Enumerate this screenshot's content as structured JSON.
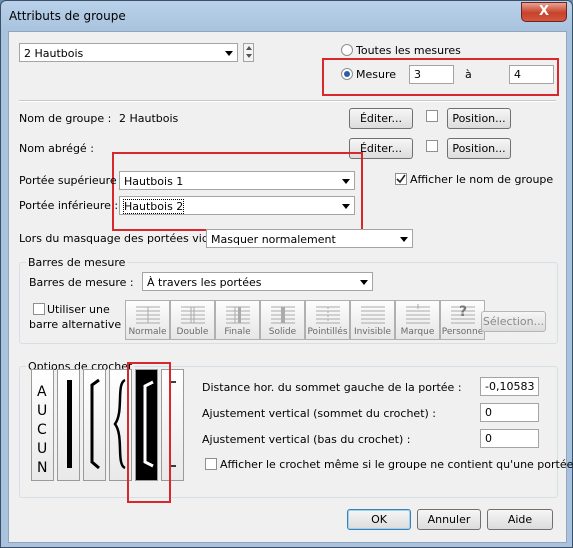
{
  "window": {
    "title": "Attributs de groupe",
    "close_glyph": "X"
  },
  "instrument_select": {
    "value": "2 Hautbois"
  },
  "range": {
    "all_label": "Toutes les mesures",
    "measure_label": "Mesure",
    "from": "3",
    "to_label": "à",
    "to": "4"
  },
  "group_name": {
    "label": "Nom de groupe :",
    "value": "2 Hautbois",
    "edit": "Éditer...",
    "position": "Position..."
  },
  "short_name": {
    "label": "Nom abrégé :",
    "edit": "Éditer...",
    "position": "Position..."
  },
  "staves": {
    "upper_label": "Portée supérieure",
    "upper_value": "Hautbois 1",
    "lower_label": "Portée inférieure :",
    "lower_value": "Hautbois 2",
    "show_name_label": "Afficher le nom de groupe"
  },
  "hide_empty": {
    "label": "Lors du masquage des portées vides :",
    "value": "Masquer normalement"
  },
  "barlines": {
    "group_title": "Barres de mesure",
    "label": "Barres de mesure :",
    "value": "À travers les portées",
    "alt_line1": "Utiliser une",
    "alt_line2": "barre alternative",
    "styles": [
      "Normale",
      "Double",
      "Finale",
      "Solide",
      "Pointillés",
      "Invisible",
      "Marque",
      "Personne"
    ],
    "custom_glyph": "?",
    "selection_btn": "Sélection..."
  },
  "bracket": {
    "group_title": "Options de crochet",
    "none_letters": [
      "A",
      "U",
      "C",
      "U",
      "N"
    ],
    "hdist_label": "Distance hor. du sommet gauche de la portée :",
    "hdist_value": "-0,10583",
    "vtop_label": "Ajustement vertical (sommet du crochet) :",
    "vtop_value": "0",
    "vbot_label": "Ajustement vertical (bas du crochet) :",
    "vbot_value": "0",
    "single_label": "Afficher le crochet même si le groupe ne contient qu'une portée"
  },
  "footer": {
    "ok": "OK",
    "cancel": "Annuler",
    "help": "Aide"
  },
  "colors": {
    "highlight": "#d8282d",
    "selected_bracket_bg": "#000000",
    "radio_dot": "#2c5ea8"
  }
}
